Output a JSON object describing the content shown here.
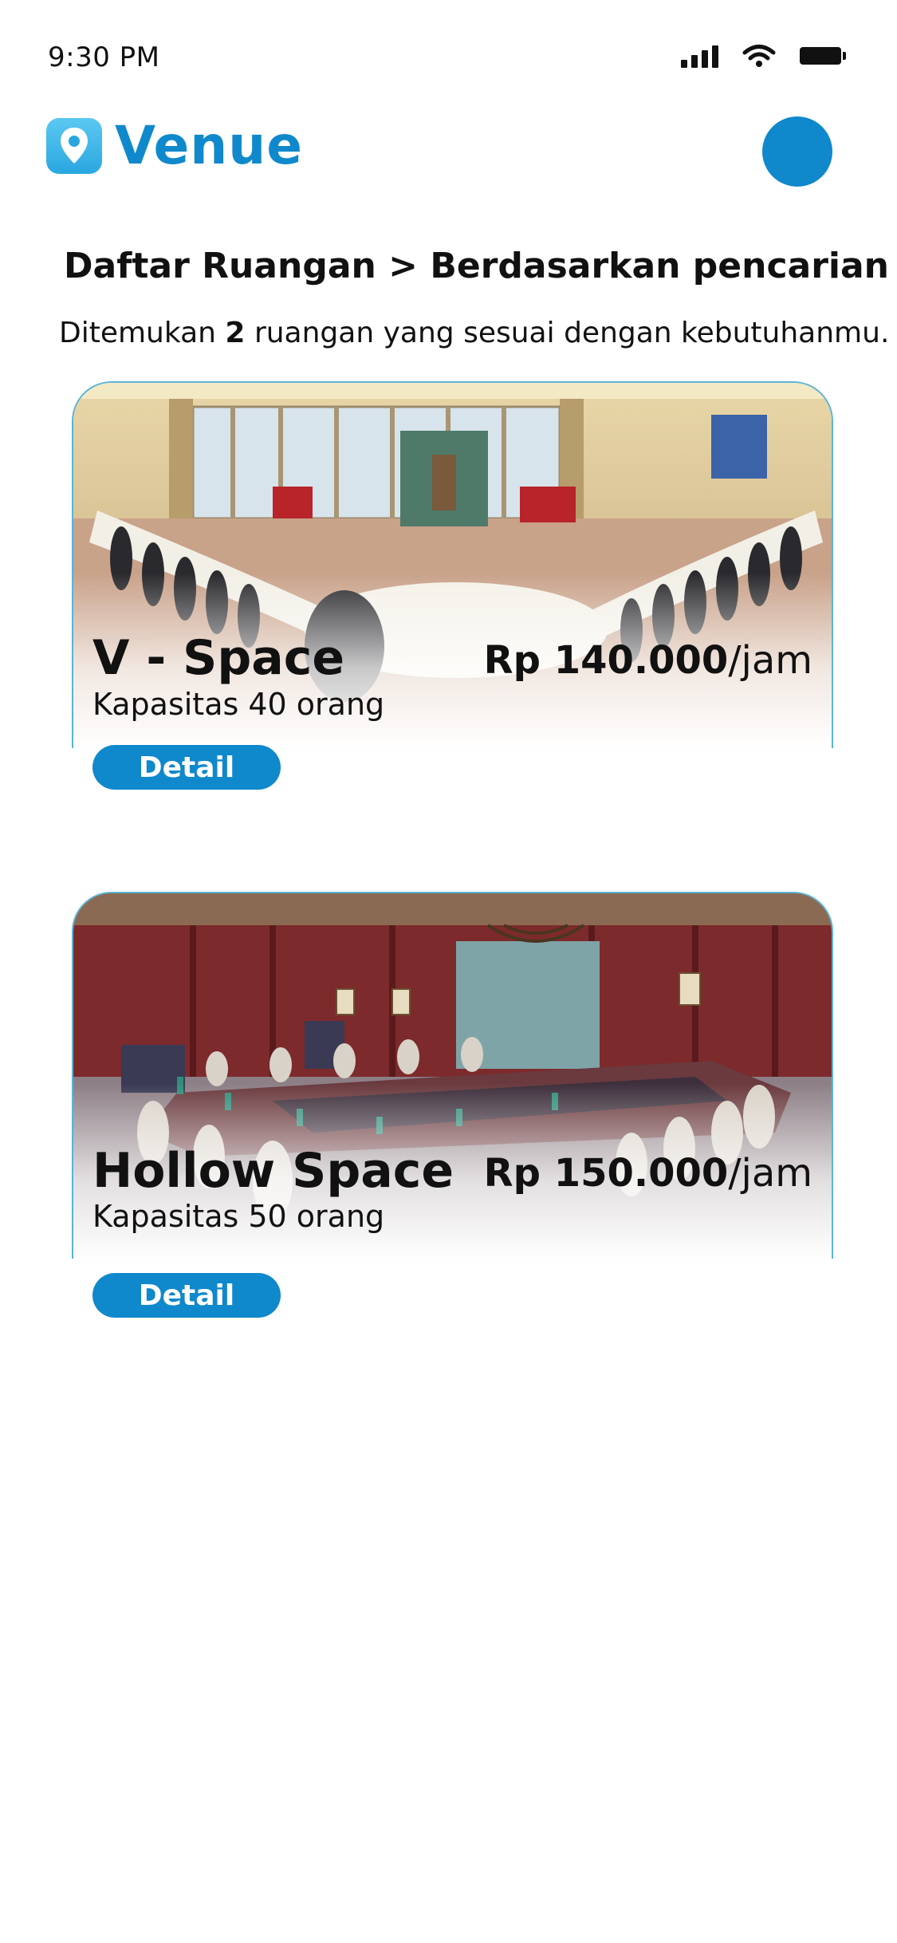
{
  "status_bar": {
    "time": "9:30 PM"
  },
  "app": {
    "name": "Venue"
  },
  "breadcrumb": "Daftar Ruangan > Berdasarkan pencarian",
  "results": {
    "prefix": "Ditemukan",
    "count": "2",
    "suffix": "ruangan yang sesuai dengan kebutuhanmu."
  },
  "rooms": [
    {
      "name": "V - Space",
      "capacity": "Kapasitas 40 orang",
      "price": "Rp 140.000",
      "unit": "/jam",
      "button": "Detail"
    },
    {
      "name": "Hollow Space",
      "capacity": "Kapasitas 50 orang",
      "price": "Rp 150.000",
      "unit": "/jam",
      "button": "Detail"
    }
  ],
  "colors": {
    "brand": "#0f88cc",
    "logo_light": "#5bc8f2"
  }
}
